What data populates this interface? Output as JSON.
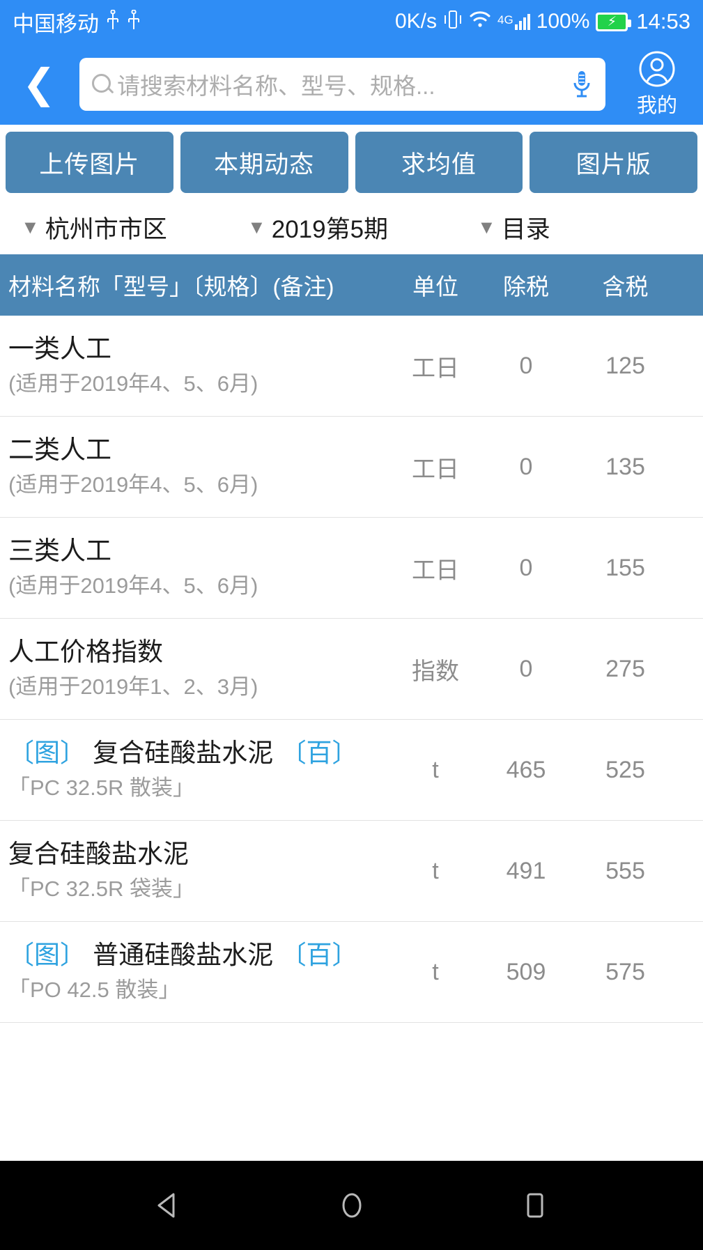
{
  "statusbar": {
    "carrier": "中国移动",
    "usb_icon_1": "usb-icon",
    "usb_icon_2": "usb-icon",
    "network_speed": "0K/s",
    "vibrate_icon": "vibrate-icon",
    "wifi_icon": "wifi-icon",
    "signal_type": "4G",
    "battery_percent": "100%",
    "battery_icon": "battery-charging-icon",
    "time": "14:53"
  },
  "appbar": {
    "back_icon": "back-chevron-icon",
    "search_placeholder": "请搜索材料名称、型号、规格...",
    "search_value": "",
    "search_icon": "search-icon",
    "mic_icon": "microphone-icon",
    "profile_icon": "profile-avatar-icon",
    "profile_label": "我的"
  },
  "actions": [
    {
      "label": "上传图片"
    },
    {
      "label": "本期动态"
    },
    {
      "label": "求均值"
    },
    {
      "label": "图片版"
    }
  ],
  "filters": [
    {
      "caret": "▼",
      "label": "杭州市市区"
    },
    {
      "caret": "▼",
      "label": "2019第5期"
    },
    {
      "caret": "▼",
      "label": "目录"
    }
  ],
  "table": {
    "headers": {
      "name": "材料名称「型号」〔规格〕(备注)",
      "unit": "单位",
      "extax": "除税",
      "intax": "含税"
    },
    "rows": [
      {
        "tag_prefix": "",
        "title": "一类人工",
        "tag_suffix": "",
        "sub": "(适用于2019年4、5、6月)",
        "unit": "工日",
        "extax": "0",
        "intax": "125"
      },
      {
        "tag_prefix": "",
        "title": "二类人工",
        "tag_suffix": "",
        "sub": "(适用于2019年4、5、6月)",
        "unit": "工日",
        "extax": "0",
        "intax": "135"
      },
      {
        "tag_prefix": "",
        "title": "三类人工",
        "tag_suffix": "",
        "sub": "(适用于2019年4、5、6月)",
        "unit": "工日",
        "extax": "0",
        "intax": "155"
      },
      {
        "tag_prefix": "",
        "title": "人工价格指数",
        "tag_suffix": "",
        "sub": "(适用于2019年1、2、3月)",
        "unit": "指数",
        "extax": "0",
        "intax": "275"
      },
      {
        "tag_prefix": "〔图〕",
        "title": "复合硅酸盐水泥",
        "tag_suffix": "〔百〕",
        "sub": "「PC 32.5R 散装」",
        "unit": "t",
        "extax": "465",
        "intax": "525"
      },
      {
        "tag_prefix": "",
        "title": "复合硅酸盐水泥",
        "tag_suffix": "",
        "sub": "「PC 32.5R 袋装」",
        "unit": "t",
        "extax": "491",
        "intax": "555"
      },
      {
        "tag_prefix": "〔图〕",
        "title": "普通硅酸盐水泥",
        "tag_suffix": "〔百〕",
        "sub": "「PO 42.5 散装」",
        "unit": "t",
        "extax": "509",
        "intax": "575"
      }
    ]
  },
  "navbar": {
    "back_icon": "android-back-icon",
    "home_icon": "android-home-icon",
    "recents_icon": "android-recents-icon"
  },
  "colors": {
    "header_blue": "#2f8df5",
    "panel_blue": "#4b86b4",
    "tag_blue": "#2fa3e0",
    "muted_text": "#8c8c8c",
    "battery_green": "#22d24a"
  }
}
